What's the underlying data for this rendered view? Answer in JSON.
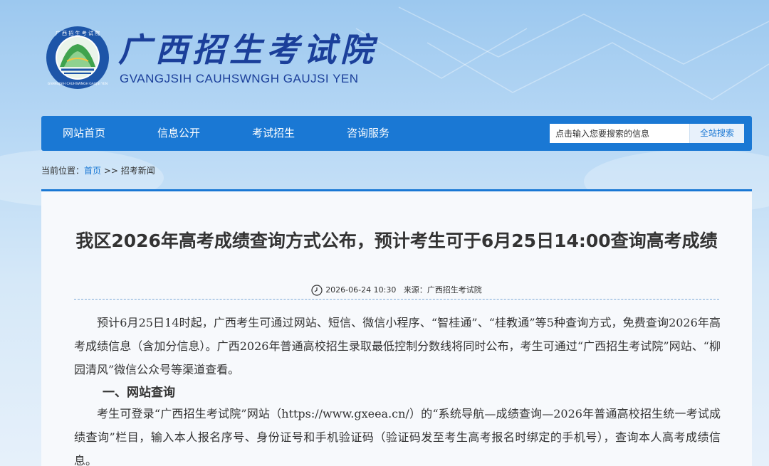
{
  "header": {
    "title": "广西招生考试院",
    "subtitle": "GVANGJSIH CAUHSWNGH GAUJSI YEN",
    "logo_ring_text": "广西招生考试院",
    "logo_bottom_text": "GVANGJSIH CAUHSWNGH GAUJSI YEN"
  },
  "nav": {
    "items": [
      "网站首页",
      "信息公开",
      "考试招生",
      "咨询服务"
    ],
    "search_placeholder": "点击输入您要搜索的信息",
    "search_button": "全站搜索"
  },
  "breadcrumb": {
    "label": "当前位置：",
    "home": "首页",
    "separator": ">>",
    "current": "招考新闻"
  },
  "article": {
    "title": "我区2026年高考成绩查询方式公布，预计考生可于6月25日14:00查询高考成绩",
    "date": "2026-06-24 10:30",
    "source_label": "来源：",
    "source": "广西招生考试院",
    "para1": "预计6月25日14时起，广西考生可通过网站、短信、微信小程序、“智桂通”、“桂教通”等5种查询方式，免费查询2026年高考成绩信息（含加分信息）。广西2026年普通高校招生录取最低控制分数线将同时公布，考生可通过“广西招生考试院”网站、“柳园清风”微信公众号等渠道查看。",
    "section1": "一、网站查询",
    "para2": "考生可登录“广西招生考试院”网站（https://www.gxeea.cn/）的“系统导航—成绩查询—2026年普通高校招生统一考试成绩查询”栏目，输入本人报名序号、身份证号和手机验证码（验证码发至考生高考报名时绑定的手机号），查询本人高考成绩信息。"
  },
  "colors": {
    "nav_bg": "#1a78d4",
    "title_blue": "#1b3f9a",
    "logo_green": "#3fa34d"
  }
}
